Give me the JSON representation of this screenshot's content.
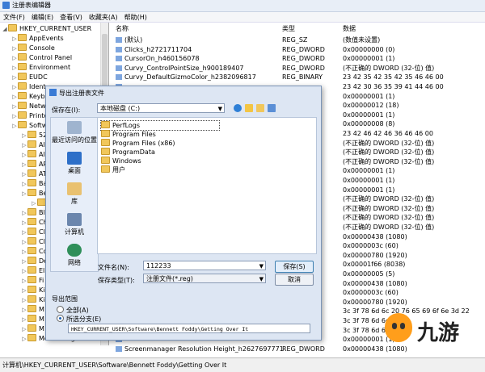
{
  "window": {
    "title": "注册表编辑器"
  },
  "menu": [
    "文件(F)",
    "编辑(E)",
    "查看(V)",
    "收藏夹(A)",
    "帮助(H)"
  ],
  "tree": {
    "items": [
      {
        "label": "HKEY_CURRENT_USER",
        "level": 0
      },
      {
        "label": "AppEvents",
        "level": 1
      },
      {
        "label": "Console",
        "level": 1
      },
      {
        "label": "Control Panel",
        "level": 1
      },
      {
        "label": "Environment",
        "level": 1
      },
      {
        "label": "EUDC",
        "level": 1
      },
      {
        "label": "Ident",
        "level": 1
      },
      {
        "label": "Keyb",
        "level": 1
      },
      {
        "label": "Netw",
        "level": 1
      },
      {
        "label": "Printe",
        "level": 1
      },
      {
        "label": "Softw",
        "level": 1
      },
      {
        "label": "52",
        "level": 2
      },
      {
        "label": "Al",
        "level": 2
      },
      {
        "label": "Al",
        "level": 2
      },
      {
        "label": "AP",
        "level": 2
      },
      {
        "label": "AT",
        "level": 2
      },
      {
        "label": "Ba",
        "level": 2
      },
      {
        "label": "Be",
        "level": 2
      },
      {
        "label": "",
        "level": 3
      },
      {
        "label": "Bl",
        "level": 2
      },
      {
        "label": "Ch",
        "level": 2
      },
      {
        "label": "Cl",
        "level": 2
      },
      {
        "label": "Cl",
        "level": 2
      },
      {
        "label": "Co",
        "level": 2
      },
      {
        "label": "De",
        "level": 2
      },
      {
        "label": "El",
        "level": 2
      },
      {
        "label": "Fi",
        "level": 2
      },
      {
        "label": "Ki",
        "level": 2
      },
      {
        "label": "Ki",
        "level": 2
      },
      {
        "label": "M",
        "level": 2
      },
      {
        "label": "M",
        "level": 2
      },
      {
        "label": "M",
        "level": 2
      },
      {
        "label": "MozillaPlugins",
        "level": 2
      }
    ]
  },
  "list": {
    "headers": {
      "name": "名称",
      "type": "类型",
      "data": "数据"
    },
    "rows": [
      {
        "name": "(默认)",
        "type": "REG_SZ",
        "data": "(数值未设置)"
      },
      {
        "name": "Clicks_h2721711704",
        "type": "REG_DWORD",
        "data": "0x00000000 (0)"
      },
      {
        "name": "CursorOn_h460156078",
        "type": "REG_DWORD",
        "data": "0x00000001 (1)"
      },
      {
        "name": "Curvy_ControlPointSize_h900189407",
        "type": "REG_DWORD",
        "data": "(不正确的 DWORD (32-位) 值)"
      },
      {
        "name": "Curvy_DefaultGizmoColor_h2382096817",
        "type": "REG_BINARY",
        "data": "23 42 35 42 35 42 35 46 46 00"
      },
      {
        "name": "",
        "type": "",
        "data": "23 42 30 36 35 39 41 44 46 00"
      },
      {
        "name": "",
        "type": "",
        "data": "0x00000001 (1)"
      },
      {
        "name": "",
        "type": "",
        "data": "0x00000012 (18)"
      },
      {
        "name": "",
        "type": "",
        "data": "0x00000001 (1)"
      },
      {
        "name": "",
        "type": "",
        "data": "0x00000008 (8)"
      },
      {
        "name": "",
        "type": "",
        "data": "23 42 46 42 46 36 46 46 00"
      },
      {
        "name": "",
        "type": "",
        "data": "(不正确的 DWORD (32-位) 值)"
      },
      {
        "name": "",
        "type": "",
        "data": "(不正确的 DWORD (32-位) 值)"
      },
      {
        "name": "",
        "type": "",
        "data": "(不正确的 DWORD (32-位) 值)"
      },
      {
        "name": "",
        "type": "",
        "data": "0x00000001 (1)"
      },
      {
        "name": "",
        "type": "",
        "data": "0x00000001 (1)"
      },
      {
        "name": "",
        "type": "",
        "data": "0x00000001 (1)"
      },
      {
        "name": "",
        "type": "",
        "data": "(不正确的 DWORD (32-位) 值)"
      },
      {
        "name": "",
        "type": "",
        "data": "(不正确的 DWORD (32-位) 值)"
      },
      {
        "name": "",
        "type": "",
        "data": "(不正确的 DWORD (32-位) 值)"
      },
      {
        "name": "",
        "type": "",
        "data": "(不正确的 DWORD (32-位) 值)"
      },
      {
        "name": "",
        "type": "",
        "data": "0x00000438 (1080)"
      },
      {
        "name": "",
        "type": "",
        "data": "0x0000003c (60)"
      },
      {
        "name": "",
        "type": "",
        "data": "0x00000780 (1920)"
      },
      {
        "name": "",
        "type": "",
        "data": "0x00001f66 (8038)"
      },
      {
        "name": "",
        "type": "",
        "data": "0x00000005 (5)"
      },
      {
        "name": "",
        "type": "",
        "data": "0x00000438 (1080)"
      },
      {
        "name": "",
        "type": "",
        "data": "0x0000003c (60)"
      },
      {
        "name": "",
        "type": "",
        "data": "0x00000780 (1920)"
      },
      {
        "name": "",
        "type": "",
        "data": "3c 3f 78 6d 6c 20 76 65 69 6f 6e 3d 22"
      },
      {
        "name": "",
        "type": "",
        "data": "3c 3f 78 6d 6c 20 76"
      },
      {
        "name": "",
        "type": "",
        "data": "3c 3f 78 6d 6c 20"
      },
      {
        "name": "",
        "type": "",
        "data": "0x00000001 (1)"
      },
      {
        "name": "Screenmanager Resolution Height_h2627697771",
        "type": "REG_DWORD",
        "data": "0x00000438 (1080)"
      }
    ]
  },
  "statusbar": {
    "path": "计算机\\HKEY_CURRENT_USER\\Software\\Bennett Foddy\\Getting Over It"
  },
  "dialog": {
    "title": "导出注册表文件",
    "save_in_label": "保存在(I):",
    "save_in_value": "本地磁盘 (C:)",
    "places": [
      "最近访问的位置",
      "桌面",
      "库",
      "计算机",
      "网络"
    ],
    "files": [
      "PerfLogs",
      "Program Files",
      "Program Files (x86)",
      "ProgramData",
      "Windows",
      "用户"
    ],
    "filename_label": "文件名(N):",
    "filename_value": "112233",
    "filetype_label": "保存类型(T):",
    "filetype_value": "注册文件(*.reg)",
    "save_button": "保存(S)",
    "cancel_button": "取消",
    "range_title": "导出范围",
    "range_all": "全部(A)",
    "range_selected": "所选分支(E)",
    "range_path": "HKEY_CURRENT_USER\\Software\\Bennett Foddy\\Getting Over It"
  },
  "watermark": {
    "text": "九游"
  }
}
